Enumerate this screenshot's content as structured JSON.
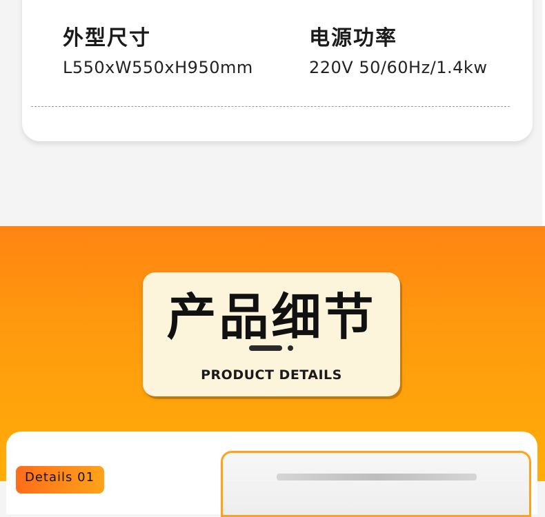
{
  "specs": {
    "size": {
      "label": "外型尺寸",
      "value": "L550xW550xH950mm"
    },
    "power": {
      "label": "电源功率",
      "value": "220V 50/60Hz/1.4kw"
    }
  },
  "section_title": {
    "cn": "产品细节",
    "en": "PRODUCT DETAILS"
  },
  "details": {
    "badge": "Details 01"
  },
  "colors": {
    "accent": "#ff9a0e",
    "card": "#fdf4dc"
  }
}
